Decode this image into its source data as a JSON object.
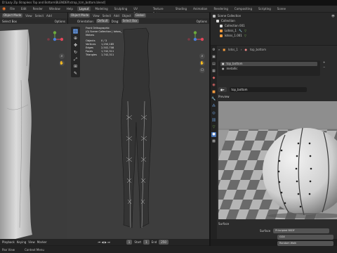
{
  "window": {
    "title": "D:\\Lazy Zip Strapless Top and Bottom\\BLENDER\\strap_tcm_bottom.blend]"
  },
  "menu": {
    "items": [
      "File",
      "Edit",
      "Render",
      "Window",
      "Help"
    ],
    "tabs": [
      "Layout",
      "Modeling",
      "Sculpting",
      "UV Editing",
      "Texture Paint",
      "Shading",
      "Animation",
      "Rendering",
      "Compositing",
      "Scripting"
    ],
    "active_tab": "Layout",
    "scene": "Scene"
  },
  "left_view": {
    "editor": "Object Mode",
    "view": "View",
    "select": "Select",
    "add": "Add",
    "object": "Object",
    "orientation": "Global",
    "select_box": "Select Box",
    "options": "Options"
  },
  "mid_view": {
    "editor": "Object Mode",
    "view": "View",
    "select": "Select",
    "add": "Add",
    "object": "Object",
    "orientation": "Global",
    "orient_label": "Orientation:",
    "orient_value": "Default",
    "drag_label": "Drag:",
    "drag_value": "Select Box",
    "options": "Options"
  },
  "stats": {
    "view": "Front Orthographic",
    "collection": "(0) Scene Collection | lotsss_",
    "unit": "Meters",
    "rows": [
      {
        "label": "Objects",
        "value": "0 / 3"
      },
      {
        "label": "Vertices",
        "value": "1,250,185"
      },
      {
        "label": "Edges",
        "value": "2,502,708"
      },
      {
        "label": "Faces",
        "value": "1,742,311"
      },
      {
        "label": "Triangles",
        "value": "1,742,311"
      }
    ]
  },
  "timeline": {
    "playback": "Playback",
    "keying": "Keying",
    "view": "View",
    "marker": "Marker",
    "frame": "1",
    "start_label": "Start",
    "start": "1",
    "end_label": "End",
    "end": "250"
  },
  "status": {
    "select": "Pan View",
    "context": "Context Menu"
  },
  "outliner": {
    "title": "Scene Collection",
    "rows": [
      "Collection",
      "Collection 001",
      "Lotsss_1",
      "lotsss_1.001"
    ]
  },
  "properties": {
    "object": "lotss_1",
    "material": "top_bottom",
    "slots": [
      "top_bottom",
      "metallic"
    ],
    "preview_label": "Preview",
    "surface_section": "Surface",
    "surface_label": "Surface",
    "surface_value": "Principled BSDF",
    "row1": "GGX",
    "row2": "Random Walk"
  },
  "colors": {
    "accent": "#4772b3",
    "viewport": "#3d3d3d",
    "panel": "#2b2b2b"
  }
}
